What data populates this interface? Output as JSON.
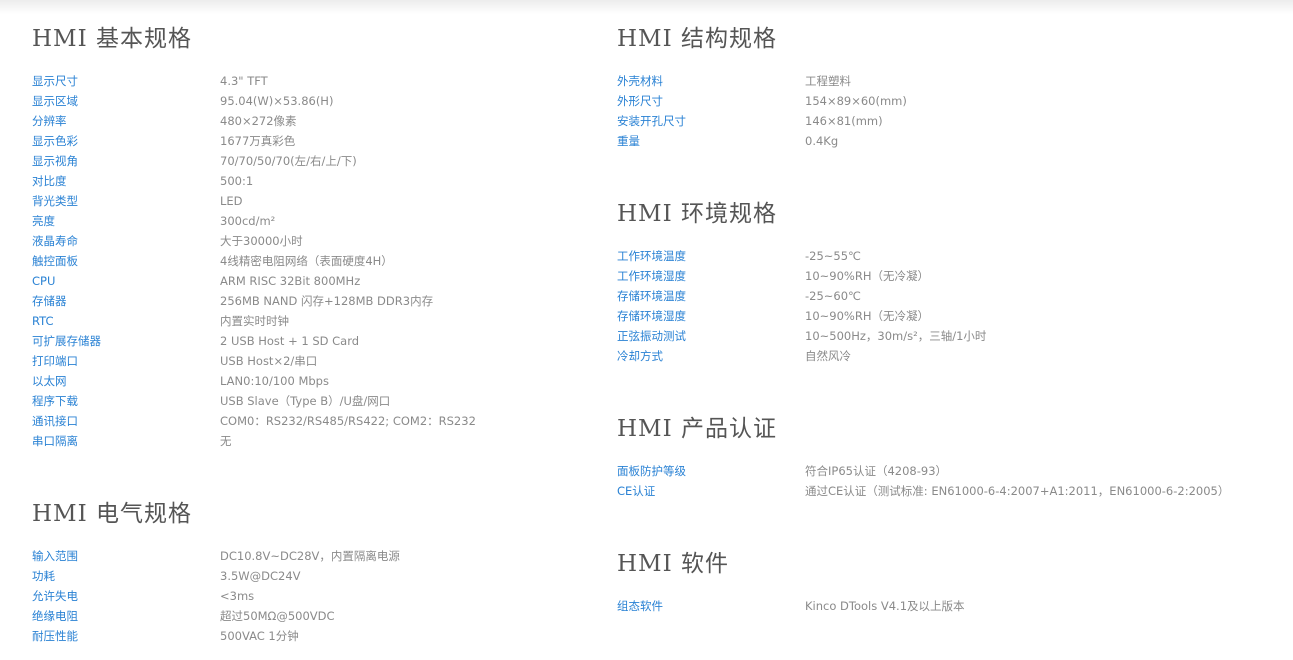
{
  "basic": {
    "title": "HMI 基本规格",
    "rows": [
      {
        "label": "显示尺寸",
        "value": "4.3\" TFT"
      },
      {
        "label": "显示区域",
        "value": "95.04(W)×53.86(H)"
      },
      {
        "label": "分辨率",
        "value": "480×272像素"
      },
      {
        "label": "显示色彩",
        "value": "1677万真彩色"
      },
      {
        "label": "显示视角",
        "value": "70/70/50/70(左/右/上/下)"
      },
      {
        "label": "对比度",
        "value": "500:1"
      },
      {
        "label": "背光类型",
        "value": "LED"
      },
      {
        "label": "亮度",
        "value": "300cd/m²"
      },
      {
        "label": "液晶寿命",
        "value": "大于30000小时"
      },
      {
        "label": "触控面板",
        "value": "4线精密电阻网络（表面硬度4H）"
      },
      {
        "label": "CPU",
        "value": "ARM RISC 32Bit 800MHz"
      },
      {
        "label": "存储器",
        "value": "256MB NAND 闪存+128MB DDR3内存"
      },
      {
        "label": "RTC",
        "value": "内置实时时钟"
      },
      {
        "label": "可扩展存储器",
        "value": "2 USB Host + 1 SD Card"
      },
      {
        "label": "打印端口",
        "value": "USB Host×2/串口"
      },
      {
        "label": "以太网",
        "value": "LAN0:10/100 Mbps"
      },
      {
        "label": "程序下载",
        "value": "USB Slave（Type B）/U盘/网口"
      },
      {
        "label": "通讯接口",
        "value": "COM0：RS232/RS485/RS422; COM2：RS232"
      },
      {
        "label": "串口隔离",
        "value": "无"
      }
    ]
  },
  "electrical": {
    "title": "HMI 电气规格",
    "rows": [
      {
        "label": "输入范围",
        "value": "DC10.8V~DC28V，内置隔离电源"
      },
      {
        "label": "功耗",
        "value": "3.5W@DC24V"
      },
      {
        "label": "允许失电",
        "value": "<3ms"
      },
      {
        "label": "绝缘电阻",
        "value": "超过50MΩ@500VDC"
      },
      {
        "label": "耐压性能",
        "value": "500VAC 1分钟"
      }
    ]
  },
  "structure": {
    "title": "HMI 结构规格",
    "rows": [
      {
        "label": "外壳材料",
        "value": "工程塑料"
      },
      {
        "label": "外形尺寸",
        "value": "154×89×60(mm)"
      },
      {
        "label": "安装开孔尺寸",
        "value": "146×81(mm)"
      },
      {
        "label": "重量",
        "value": "0.4Kg"
      }
    ]
  },
  "environment": {
    "title": "HMI 环境规格",
    "rows": [
      {
        "label": "工作环境温度",
        "value": "-25~55℃"
      },
      {
        "label": "工作环境湿度",
        "value": "10~90%RH（无冷凝）"
      },
      {
        "label": "存储环境温度",
        "value": "-25~60℃"
      },
      {
        "label": "存储环境湿度",
        "value": "10~90%RH（无冷凝）"
      },
      {
        "label": "正弦振动测试",
        "value": "10~500Hz，30m/s²，三轴/1小时"
      },
      {
        "label": "冷却方式",
        "value": "自然风冷"
      }
    ]
  },
  "certification": {
    "title": "HMI 产品认证",
    "rows": [
      {
        "label": "面板防护等级",
        "value": "符合IP65认证（4208-93）"
      },
      {
        "label": "CE认证",
        "value": "通过CE认证（测试标准: EN61000-6-4:2007+A1:2011，EN61000-6-2:2005）"
      }
    ]
  },
  "software": {
    "title": "HMI 软件",
    "rows": [
      {
        "label": "组态软件",
        "value": "Kinco DTools V4.1及以上版本"
      }
    ]
  },
  "colors": {
    "label": "#2a82d4",
    "value": "#8a8a8a",
    "heading": "#555555"
  }
}
